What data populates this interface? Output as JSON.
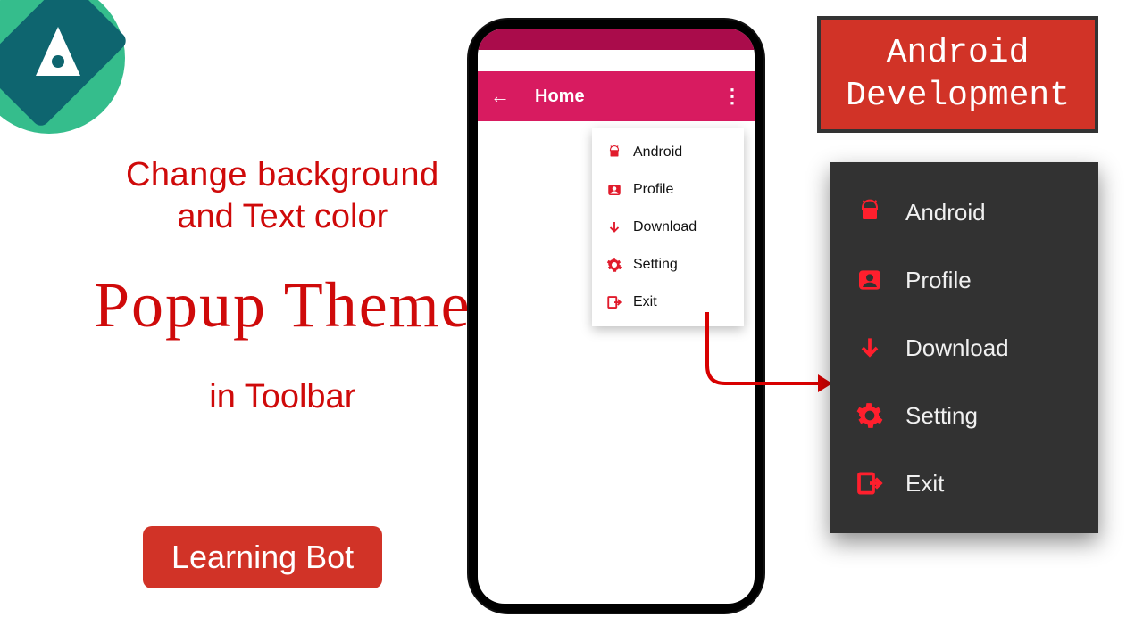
{
  "headline": {
    "line1": "Change background",
    "line2": "and Text color",
    "big": "Popup Theme",
    "line4": "in Toolbar"
  },
  "pill_label": "Learning Bot",
  "banner": {
    "line1": "Android",
    "line2": "Development"
  },
  "toolbar": {
    "title": "Home"
  },
  "menu": {
    "items": [
      {
        "label": "Android",
        "icon": "android-robot-icon"
      },
      {
        "label": "Profile",
        "icon": "user-card-icon"
      },
      {
        "label": "Download",
        "icon": "arrow-down-icon"
      },
      {
        "label": "Setting",
        "icon": "gear-icon"
      },
      {
        "label": "Exit",
        "icon": "exit-icon"
      }
    ]
  },
  "colors": {
    "accent": "#d81b60",
    "danger": "#e11b2c",
    "dark_bg": "#323232"
  }
}
